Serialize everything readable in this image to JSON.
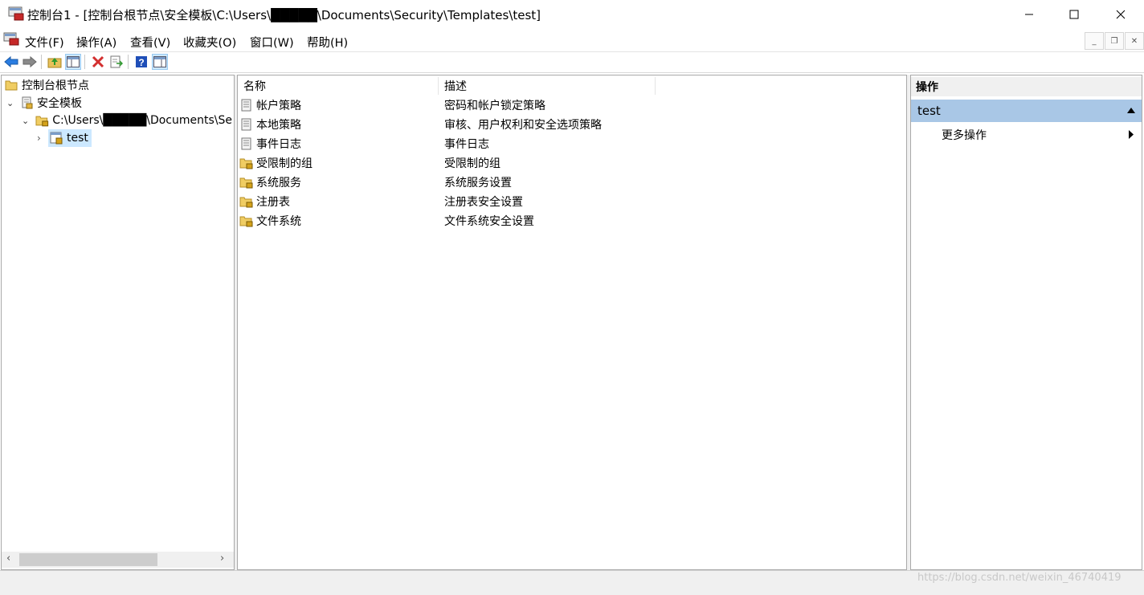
{
  "window": {
    "title": "控制台1 - [控制台根节点\\安全模板\\C:\\Users\\█████\\Documents\\Security\\Templates\\test]",
    "minimize": "–",
    "maximize": "☐",
    "close": "✕"
  },
  "menu": {
    "items": [
      "文件(F)",
      "操作(A)",
      "查看(V)",
      "收藏夹(O)",
      "窗口(W)",
      "帮助(H)"
    ],
    "mdi_minimize": "_",
    "mdi_restore": "❐",
    "mdi_close": "✕"
  },
  "toolbar": {
    "icons": [
      "back-icon",
      "forward-icon",
      "up-folder-icon",
      "show-tree-icon",
      "delete-icon",
      "export-icon",
      "help-icon",
      "action-pane-icon"
    ]
  },
  "tree": {
    "root": "控制台根节点",
    "templates": "安全模板",
    "path": "C:\\Users\\█████\\Documents\\Se",
    "selected": "test"
  },
  "list": {
    "headers": [
      "名称",
      "描述"
    ],
    "rows": [
      {
        "name": "帐户策略",
        "desc": "密码和帐户锁定策略",
        "icon": "policy-icon"
      },
      {
        "name": "本地策略",
        "desc": "审核、用户权利和安全选项策略",
        "icon": "policy-icon"
      },
      {
        "name": "事件日志",
        "desc": "事件日志",
        "icon": "policy-icon"
      },
      {
        "name": "受限制的组",
        "desc": "受限制的组",
        "icon": "locked-folder-icon"
      },
      {
        "name": "系统服务",
        "desc": "系统服务设置",
        "icon": "locked-folder-icon"
      },
      {
        "name": "注册表",
        "desc": "注册表安全设置",
        "icon": "locked-folder-icon"
      },
      {
        "name": "文件系统",
        "desc": "文件系统安全设置",
        "icon": "locked-folder-icon"
      }
    ]
  },
  "actions": {
    "header": "操作",
    "section": "test",
    "more": "更多操作"
  },
  "statusbar": {
    "watermark": "https://blog.csdn.net/weixin_46740419"
  },
  "colors": {
    "selection": "#cce8ff",
    "action_section": "#a9c7e6",
    "delete_red": "#d32f2f",
    "help_blue": "#1f4fb8"
  }
}
